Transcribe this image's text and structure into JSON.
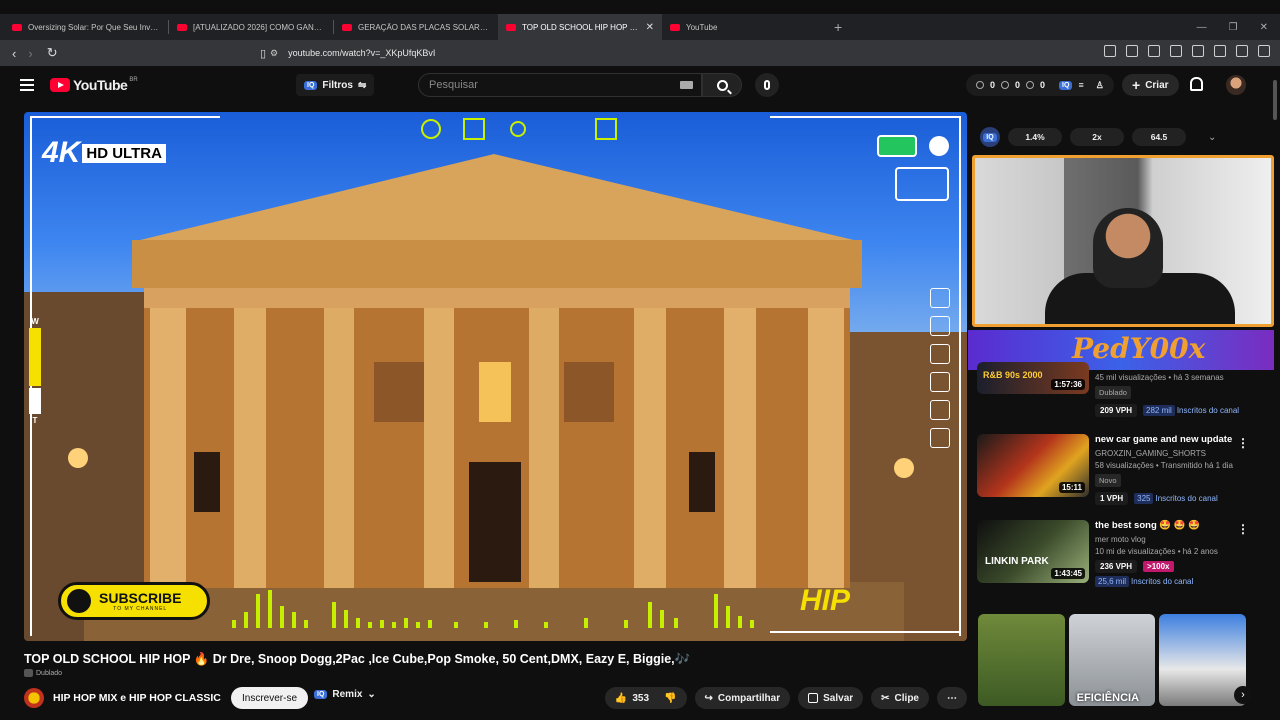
{
  "browser": {
    "tabs": [
      {
        "title": "Oversizing Solar: Por Que Seu Inverso",
        "active": false
      },
      {
        "title": "[ATUALIZADO 2026] COMO GANHAR",
        "active": false
      },
      {
        "title": "GERAÇÃO DAS PLACAS SOLAR EM D",
        "active": false
      },
      {
        "title": "TOP OLD SCHOOL HIP HOP 🔥 D",
        "active": true
      },
      {
        "title": "YouTube",
        "active": false
      }
    ],
    "url": "youtube.com/watch?v=_XKpUfqKBvI"
  },
  "header": {
    "logo_text": "YouTube",
    "country": "BR",
    "filters_label": "Filtros",
    "search_placeholder": "Pesquisar",
    "stats": [
      "0",
      "0",
      "0"
    ],
    "create_label": "Criar"
  },
  "player": {
    "hd_badge": "HD ULTRA",
    "k_badge": "4K",
    "subscribe": "SUBSCRIBE",
    "subscribe_sub": "TO MY CHANNEL",
    "hip_logo": "HIP",
    "level_top": "W",
    "level_bottom": "T"
  },
  "video": {
    "title": "TOP OLD SCHOOL HIP HOP 🔥 Dr Dre, Snoop Dogg,2Pac ,Ice Cube,Pop Smoke, 50 Cent,DMX, Eazy E, Biggie,🎶",
    "dubbed": "Dublado",
    "channel": "HIP HOP MIX e HIP HOP CLASSIC",
    "subscribe_label": "Inscrever-se",
    "remix_label": "Remix",
    "likes": "353",
    "share_label": "Compartilhar",
    "save_label": "Salvar",
    "clip_label": "Clipe"
  },
  "extension": {
    "label": "IQ",
    "metrics": [
      "1.4%",
      "2x",
      "64.5"
    ]
  },
  "banner_text": "PedY00x",
  "recommendations": [
    {
      "title": "",
      "duration": "1:57:36",
      "thumb_label": "R&B 90s 2000",
      "views": "45 mil visualizações • há 3 semanas",
      "badge": "Dublado",
      "vph": "209 VPH",
      "subs_num": "282 mil",
      "subs_label": "Inscritos do canal"
    },
    {
      "title": "new car game and new update",
      "channel": "GROXZIN_GAMING_SHORTS",
      "duration": "15:11",
      "views": "58 visualizações • Transmitido há 1 dia",
      "badge": "Novo",
      "vph": "1 VPH",
      "subs_num": "325",
      "subs_label": "Inscritos do canal"
    },
    {
      "title": "the best song 🤩 🤩 🤩",
      "channel": "mer moto vlog",
      "duration": "1:43:45",
      "thumb_label": "LINKIN PARK",
      "views": "10 mi de visualizações • há 2 anos",
      "vph": "236 VPH",
      "hot": ">100x",
      "subs_num": "25,6 mil",
      "subs_label": "Inscritos do canal"
    }
  ],
  "shorts_caption": "EFICIÊNCIA",
  "colors": {
    "accent_red": "#ff0033",
    "webcam_border": "#f0a030",
    "subscribe_yellow": "#f5e000",
    "hot_badge": "#c0196b"
  }
}
